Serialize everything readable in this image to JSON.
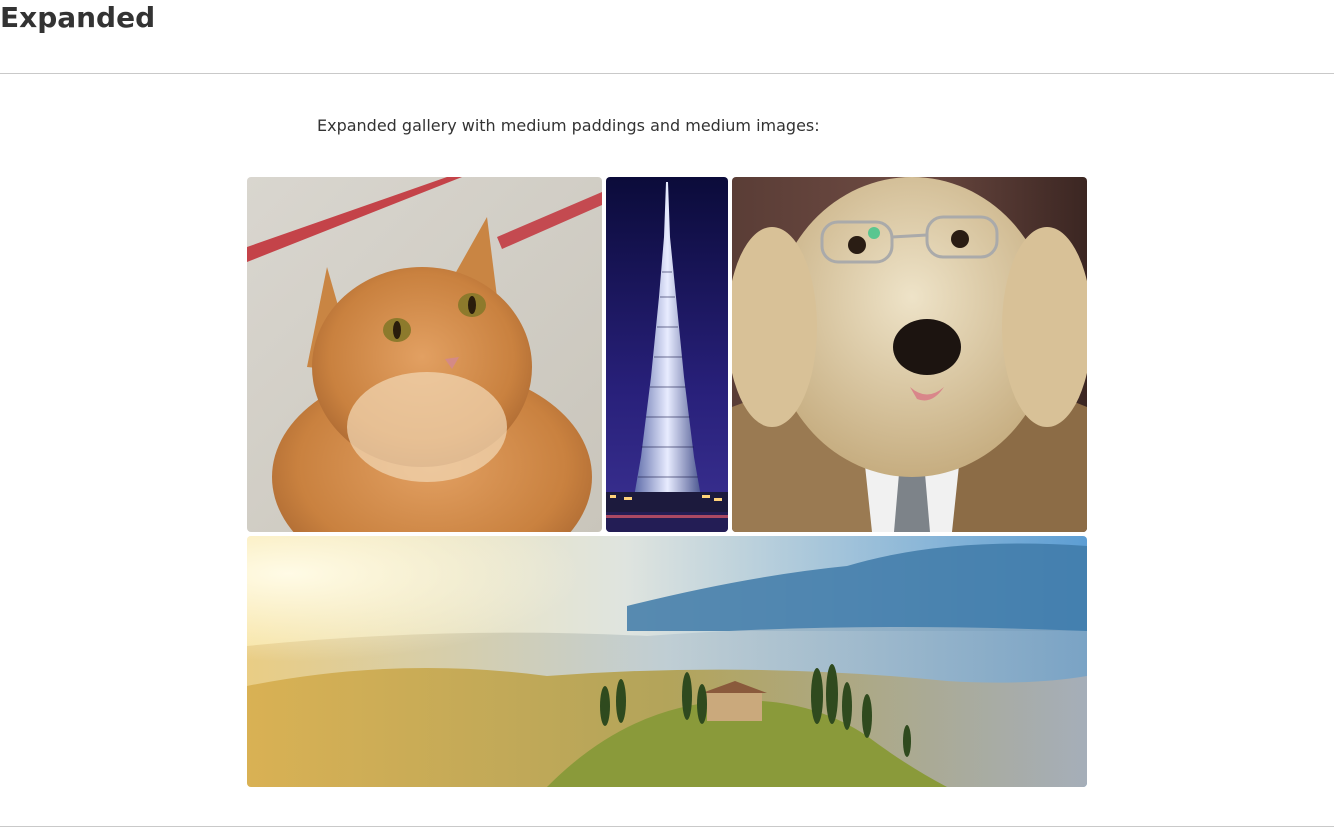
{
  "section": {
    "title": "Expanded"
  },
  "gallery": {
    "caption": "Expanded gallery with medium paddings and medium images:",
    "images": [
      {
        "subject": "orange tabby cat"
      },
      {
        "subject": "illuminated skyscraper at night"
      },
      {
        "subject": "golden retriever wearing glasses and a suit"
      },
      {
        "subject": "misty countryside landscape at sunrise"
      }
    ]
  }
}
